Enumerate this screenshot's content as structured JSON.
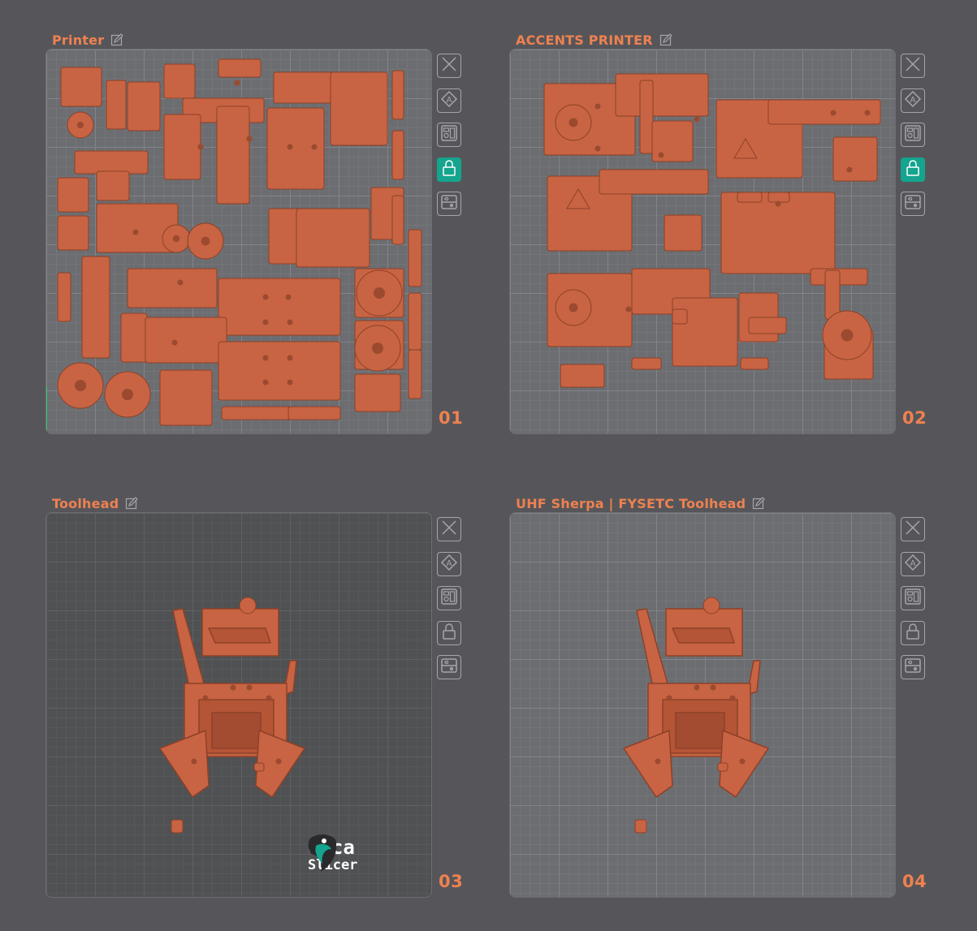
{
  "colors": {
    "background": "#56565a",
    "accent": "#ee8150",
    "part": "#c86443",
    "lock_active": "#15a48e",
    "tool_border": "#a5a6aa"
  },
  "plates": [
    {
      "name": "Printer",
      "number": "01",
      "style": "light",
      "content": "many-parts",
      "lock_active": true,
      "has_axes": true,
      "has_logo": false
    },
    {
      "name": "ACCENTS PRINTER",
      "number": "02",
      "style": "light",
      "content": "many-parts",
      "lock_active": true,
      "has_axes": false,
      "has_logo": false
    },
    {
      "name": "Toolhead",
      "number": "03",
      "style": "dark",
      "content": "toolhead-assembly",
      "lock_active": false,
      "has_axes": false,
      "has_logo": true
    },
    {
      "name": "UHF Sherpa | FYSETC Toolhead",
      "number": "04",
      "style": "light",
      "content": "toolhead-assembly",
      "lock_active": false,
      "has_axes": false,
      "has_logo": false
    }
  ],
  "toolbar_icons": [
    "close-icon",
    "auto-arrange-icon",
    "orient-icon",
    "lock-icon",
    "plate-settings-icon"
  ],
  "logo": {
    "line1": "Orca",
    "line2": "Slicer",
    "icon": "orca-logo-icon"
  }
}
